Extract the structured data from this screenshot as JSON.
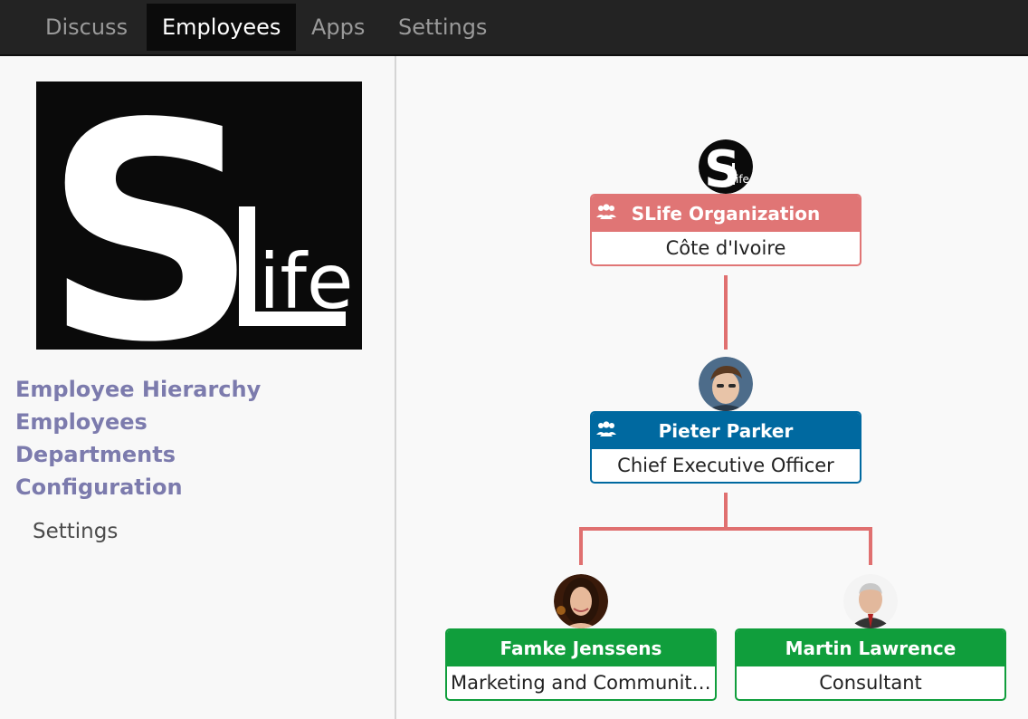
{
  "topbar": {
    "tabs": [
      {
        "label": "Discuss"
      },
      {
        "label": "Employees"
      },
      {
        "label": "Apps"
      },
      {
        "label": "Settings"
      }
    ]
  },
  "sidebar": {
    "menu": [
      {
        "label": "Employee Hierarchy"
      },
      {
        "label": "Employees"
      },
      {
        "label": "Departments"
      },
      {
        "label": "Configuration"
      }
    ],
    "submenu": [
      {
        "label": "Settings"
      }
    ]
  },
  "org_chart": {
    "root": {
      "name": "SLife Organization",
      "subtitle": "Côte d'Ivoire",
      "color": "#e07575"
    },
    "ceo": {
      "name": "Pieter Parker",
      "subtitle": "Chief Executive Officer",
      "color": "#0069a0"
    },
    "children": [
      {
        "name": "Famke Jenssens",
        "subtitle": "Marketing and Community Manager",
        "color": "#109e3c"
      },
      {
        "name": "Martin Lawrence",
        "subtitle": "Consultant",
        "color": "#109e3c"
      }
    ],
    "connector_color": "#e07070",
    "icons": [
      "group-icon"
    ]
  }
}
